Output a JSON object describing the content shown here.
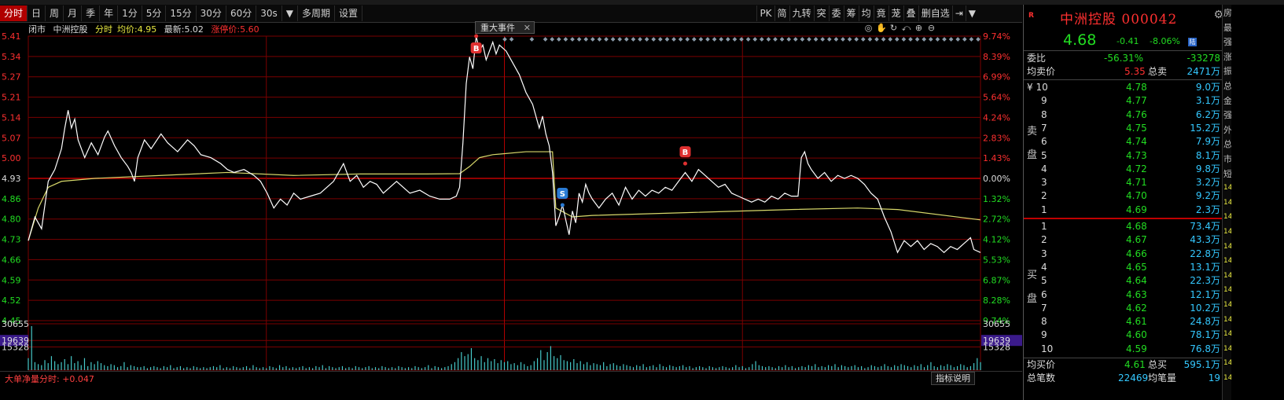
{
  "toolbar": {
    "periods": [
      "分时",
      "日",
      "周",
      "月",
      "季",
      "年",
      "1分",
      "5分",
      "15分",
      "30分",
      "60分",
      "30s",
      "▼",
      "多周期",
      "设置"
    ],
    "right_tools": [
      "PK",
      "简",
      "九转",
      "突",
      "委",
      "筹",
      "均",
      "竟",
      "茏",
      "叠",
      "删自选",
      "⇥",
      "▼"
    ]
  },
  "info": {
    "status": "闭市",
    "name": "中洲控股",
    "mode": "分时",
    "avg_label": "均价:",
    "avg": "4.95",
    "last_label": "最新:",
    "last": "5.02",
    "limit_label": "涨停价:",
    "limit": "5.60"
  },
  "events": {
    "label": "重大事件",
    "close": "✕"
  },
  "tools": [
    "◎",
    "✋",
    "↻",
    "⤺",
    "⊕",
    "⊖"
  ],
  "footer": {
    "indicator": "大单净量分时: +0.047",
    "help": "指标说明"
  },
  "chart_data": {
    "type": "line",
    "y_left_ticks": [
      "5.41",
      "5.34",
      "5.27",
      "5.21",
      "5.14",
      "5.07",
      "5.00",
      "4.93",
      "4.86",
      "4.80",
      "4.73",
      "4.66",
      "4.59",
      "4.52",
      "4.45"
    ],
    "y_right_ticks": [
      "9.74%",
      "8.39%",
      "6.99%",
      "5.64%",
      "4.24%",
      "2.83%",
      "1.43%",
      "0.00%",
      "1.32%",
      "2.72%",
      "4.12%",
      "5.53%",
      "6.87%",
      "8.28%",
      "9.74%"
    ],
    "ylim": [
      4.45,
      5.41
    ],
    "prev_close": 4.93,
    "vol_ticks_left": [
      "30655",
      "19639",
      "15328"
    ],
    "vol_ticks_right": [
      "30655",
      "19639",
      "15328"
    ],
    "vol_max": 30655,
    "highlight_volume": "19639",
    "marks": [
      {
        "label": "B",
        "t": 135,
        "price": 5.41,
        "color": "#e03030"
      },
      {
        "label": "S",
        "t": 161,
        "price": 4.84,
        "color": "#2a7bd4"
      },
      {
        "label": "B",
        "t": 198,
        "price": 4.98,
        "color": "#e03030"
      }
    ],
    "price_line": [
      [
        0,
        4.72
      ],
      [
        2,
        4.8
      ],
      [
        4,
        4.76
      ],
      [
        6,
        4.92
      ],
      [
        8,
        4.96
      ],
      [
        10,
        5.03
      ],
      [
        11,
        5.1
      ],
      [
        12,
        5.16
      ],
      [
        13,
        5.1
      ],
      [
        14,
        5.13
      ],
      [
        15,
        5.06
      ],
      [
        17,
        5.0
      ],
      [
        19,
        5.05
      ],
      [
        21,
        5.01
      ],
      [
        23,
        5.07
      ],
      [
        24,
        5.09
      ],
      [
        26,
        5.04
      ],
      [
        28,
        5.0
      ],
      [
        30,
        4.97
      ],
      [
        31,
        4.95
      ],
      [
        32,
        4.92
      ],
      [
        33,
        5.0
      ],
      [
        35,
        5.06
      ],
      [
        37,
        5.03
      ],
      [
        40,
        5.08
      ],
      [
        42,
        5.05
      ],
      [
        45,
        5.02
      ],
      [
        48,
        5.06
      ],
      [
        50,
        5.04
      ],
      [
        52,
        5.01
      ],
      [
        55,
        5.0
      ],
      [
        58,
        4.98
      ],
      [
        60,
        4.96
      ],
      [
        62,
        4.95
      ],
      [
        65,
        4.96
      ],
      [
        68,
        4.94
      ],
      [
        70,
        4.92
      ],
      [
        72,
        4.88
      ],
      [
        74,
        4.83
      ],
      [
        76,
        4.86
      ],
      [
        78,
        4.84
      ],
      [
        80,
        4.88
      ],
      [
        82,
        4.86
      ],
      [
        85,
        4.87
      ],
      [
        88,
        4.88
      ],
      [
        90,
        4.9
      ],
      [
        92,
        4.92
      ],
      [
        94,
        4.96
      ],
      [
        95,
        4.98
      ],
      [
        97,
        4.92
      ],
      [
        99,
        4.94
      ],
      [
        101,
        4.9
      ],
      [
        103,
        4.92
      ],
      [
        105,
        4.91
      ],
      [
        107,
        4.88
      ],
      [
        109,
        4.9
      ],
      [
        111,
        4.92
      ],
      [
        113,
        4.9
      ],
      [
        115,
        4.88
      ],
      [
        118,
        4.89
      ],
      [
        121,
        4.87
      ],
      [
        124,
        4.86
      ],
      [
        127,
        4.86
      ],
      [
        129,
        4.87
      ],
      [
        130,
        4.9
      ],
      [
        131,
        5.05
      ],
      [
        132,
        5.25
      ],
      [
        133,
        5.34
      ],
      [
        134,
        5.3
      ],
      [
        135,
        5.41
      ],
      [
        136,
        5.36
      ],
      [
        137,
        5.38
      ],
      [
        138,
        5.33
      ],
      [
        139,
        5.36
      ],
      [
        140,
        5.39
      ],
      [
        141,
        5.35
      ],
      [
        142,
        5.38
      ],
      [
        144,
        5.36
      ],
      [
        146,
        5.32
      ],
      [
        148,
        5.28
      ],
      [
        150,
        5.22
      ],
      [
        152,
        5.18
      ],
      [
        154,
        5.1
      ],
      [
        155,
        5.14
      ],
      [
        156,
        5.08
      ],
      [
        157,
        5.04
      ],
      [
        158,
        4.95
      ],
      [
        159,
        4.77
      ],
      [
        160,
        4.8
      ],
      [
        161,
        4.84
      ],
      [
        162,
        4.79
      ],
      [
        163,
        4.74
      ],
      [
        164,
        4.82
      ],
      [
        165,
        4.78
      ],
      [
        166,
        4.88
      ],
      [
        167,
        4.85
      ],
      [
        168,
        4.91
      ],
      [
        169,
        4.88
      ],
      [
        170,
        4.86
      ],
      [
        172,
        4.83
      ],
      [
        174,
        4.86
      ],
      [
        176,
        4.88
      ],
      [
        178,
        4.84
      ],
      [
        180,
        4.9
      ],
      [
        182,
        4.86
      ],
      [
        184,
        4.89
      ],
      [
        186,
        4.87
      ],
      [
        188,
        4.89
      ],
      [
        190,
        4.88
      ],
      [
        192,
        4.9
      ],
      [
        194,
        4.89
      ],
      [
        196,
        4.92
      ],
      [
        198,
        4.95
      ],
      [
        200,
        4.92
      ],
      [
        202,
        4.96
      ],
      [
        204,
        4.94
      ],
      [
        206,
        4.92
      ],
      [
        208,
        4.9
      ],
      [
        210,
        4.91
      ],
      [
        212,
        4.88
      ],
      [
        214,
        4.87
      ],
      [
        216,
        4.86
      ],
      [
        218,
        4.85
      ],
      [
        220,
        4.86
      ],
      [
        222,
        4.85
      ],
      [
        224,
        4.87
      ],
      [
        226,
        4.86
      ],
      [
        228,
        4.88
      ],
      [
        230,
        4.87
      ],
      [
        232,
        4.87
      ],
      [
        233,
        5.0
      ],
      [
        234,
        5.02
      ],
      [
        235,
        4.98
      ],
      [
        236,
        4.96
      ],
      [
        238,
        4.93
      ],
      [
        240,
        4.95
      ],
      [
        242,
        4.92
      ],
      [
        244,
        4.94
      ],
      [
        246,
        4.93
      ],
      [
        248,
        4.94
      ],
      [
        250,
        4.93
      ],
      [
        252,
        4.91
      ],
      [
        254,
        4.88
      ],
      [
        256,
        4.86
      ],
      [
        258,
        4.8
      ],
      [
        260,
        4.75
      ],
      [
        262,
        4.68
      ],
      [
        264,
        4.72
      ],
      [
        266,
        4.7
      ],
      [
        268,
        4.72
      ],
      [
        270,
        4.69
      ],
      [
        272,
        4.71
      ],
      [
        274,
        4.7
      ],
      [
        276,
        4.68
      ],
      [
        278,
        4.7
      ],
      [
        280,
        4.69
      ],
      [
        282,
        4.71
      ],
      [
        284,
        4.73
      ],
      [
        285,
        4.69
      ],
      [
        287,
        4.68
      ]
    ],
    "avg_line": [
      [
        0,
        4.72
      ],
      [
        3,
        4.83
      ],
      [
        6,
        4.9
      ],
      [
        10,
        4.92
      ],
      [
        20,
        4.93
      ],
      [
        40,
        4.94
      ],
      [
        60,
        4.95
      ],
      [
        80,
        4.94
      ],
      [
        100,
        4.945
      ],
      [
        120,
        4.945
      ],
      [
        130,
        4.946
      ],
      [
        133,
        4.97
      ],
      [
        136,
        5.0
      ],
      [
        140,
        5.01
      ],
      [
        150,
        5.02
      ],
      [
        158,
        5.02
      ],
      [
        159,
        4.83
      ],
      [
        164,
        4.8
      ],
      [
        170,
        4.805
      ],
      [
        200,
        4.815
      ],
      [
        230,
        4.825
      ],
      [
        250,
        4.83
      ],
      [
        262,
        4.825
      ],
      [
        287,
        4.79
      ]
    ],
    "volume": [
      12,
      44,
      8,
      6,
      5,
      10,
      7,
      14,
      9,
      6,
      8,
      11,
      6,
      14,
      7,
      9,
      5,
      12,
      4,
      8,
      6,
      9,
      7,
      5,
      4,
      6,
      5,
      3,
      4,
      8,
      3,
      5,
      4,
      3,
      3,
      4,
      2,
      3,
      4,
      3,
      2,
      4,
      3,
      5,
      2,
      3,
      4,
      2,
      3,
      2,
      4,
      3,
      2,
      3,
      2,
      3,
      4,
      3,
      5,
      2,
      3,
      2,
      4,
      3,
      2,
      3,
      4,
      2,
      5,
      3,
      2,
      3,
      2,
      4,
      3,
      2,
      5,
      3,
      4,
      2,
      3,
      2,
      3,
      4,
      2,
      3,
      2,
      4,
      3,
      5,
      2,
      4,
      3,
      2,
      3,
      4,
      2,
      3,
      2,
      4,
      3,
      2,
      3,
      4,
      2,
      3,
      2,
      4,
      3,
      2,
      3,
      2,
      4,
      3,
      2,
      3,
      2,
      4,
      3,
      2,
      3,
      5,
      2,
      4,
      3,
      2,
      3,
      4,
      6,
      8,
      12,
      18,
      14,
      16,
      22,
      12,
      10,
      14,
      8,
      12,
      9,
      11,
      7,
      10,
      8,
      9,
      6,
      7,
      5,
      8,
      6,
      4,
      5,
      9,
      12,
      20,
      10,
      18,
      24,
      14,
      12,
      15,
      10,
      9,
      8,
      11,
      7,
      9,
      6,
      8,
      5,
      7,
      6,
      5,
      8,
      4,
      6,
      7,
      5,
      4,
      6,
      5,
      4,
      3,
      5,
      4,
      6,
      3,
      4,
      5,
      3,
      6,
      4,
      3,
      5,
      4,
      3,
      4,
      5,
      3,
      4,
      2,
      3,
      4,
      3,
      2,
      4,
      3,
      2,
      3,
      4,
      3,
      2,
      3,
      5,
      3,
      4,
      2,
      3,
      6,
      9,
      5,
      4,
      3,
      4,
      3,
      2,
      4,
      3,
      5,
      3,
      4,
      2,
      3,
      4,
      3,
      5,
      4,
      6,
      3,
      4,
      3,
      5,
      4,
      6,
      3,
      5,
      4,
      3,
      4,
      5,
      3,
      4,
      2,
      3,
      5,
      4,
      3,
      4,
      6,
      4,
      3,
      5,
      4,
      6,
      5,
      4,
      3,
      5,
      4,
      6,
      3,
      5,
      8,
      4,
      3,
      5,
      4,
      6,
      5,
      3,
      4,
      6,
      5,
      3,
      4,
      7,
      12,
      8
    ]
  },
  "quote": {
    "logo": "R",
    "name": "中洲控股",
    "code": "000042",
    "price": "4.68",
    "change": "-0.41",
    "change_pct": "-8.06%",
    "market": "陆",
    "ratio_label": "委比",
    "ratio": "-56.31%",
    "ratio_diff": "-33278",
    "avg_sell_label": "均卖价",
    "avg_sell": "5.35",
    "total_sell_label": "总卖",
    "total_sell": "2471万",
    "sell_side": "卖盘",
    "buy_side": "买盘",
    "asks": [
      {
        "lv": "¥ 10",
        "price": "4.78",
        "vol": "9.0万"
      },
      {
        "lv": "9",
        "price": "4.77",
        "vol": "3.1万"
      },
      {
        "lv": "8",
        "price": "4.76",
        "vol": "6.2万"
      },
      {
        "lv": "7",
        "price": "4.75",
        "vol": "15.2万"
      },
      {
        "lv": "6",
        "price": "4.74",
        "vol": "7.9万"
      },
      {
        "lv": "5",
        "price": "4.73",
        "vol": "8.1万"
      },
      {
        "lv": "4",
        "price": "4.72",
        "vol": "9.8万"
      },
      {
        "lv": "3",
        "price": "4.71",
        "vol": "3.2万"
      },
      {
        "lv": "2",
        "price": "4.70",
        "vol": "9.2万"
      },
      {
        "lv": "1",
        "price": "4.69",
        "vol": "2.3万"
      }
    ],
    "bids": [
      {
        "lv": "1",
        "price": "4.68",
        "vol": "73.4万"
      },
      {
        "lv": "2",
        "price": "4.67",
        "vol": "43.3万"
      },
      {
        "lv": "3",
        "price": "4.66",
        "vol": "22.8万"
      },
      {
        "lv": "4",
        "price": "4.65",
        "vol": "13.1万"
      },
      {
        "lv": "5",
        "price": "4.64",
        "vol": "22.3万"
      },
      {
        "lv": "6",
        "price": "4.63",
        "vol": "12.1万"
      },
      {
        "lv": "7",
        "price": "4.62",
        "vol": "10.2万"
      },
      {
        "lv": "8",
        "price": "4.61",
        "vol": "24.8万"
      },
      {
        "lv": "9",
        "price": "4.60",
        "vol": "78.1万"
      },
      {
        "lv": "10",
        "price": "4.59",
        "vol": "76.8万"
      }
    ],
    "avg_buy_label": "均买价",
    "avg_buy": "4.61",
    "total_buy_label": "总买",
    "total_buy": "595.1万",
    "trades_label": "总笔数",
    "trades": "22469",
    "avg_lot_label": "均笔量",
    "avg_lot": "19"
  },
  "side_tabs": [
    "房",
    "最",
    "强",
    "涨",
    "振",
    "总",
    "金",
    "强",
    "外",
    "总",
    "市",
    "短",
    "14",
    "14",
    "14",
    "14",
    "14",
    "14",
    "14",
    "14",
    "14",
    "14",
    "14",
    "14",
    "14",
    "14"
  ],
  "colors": {
    "up": "#ff3030",
    "down": "#22dd22",
    "grid": "#7a0000",
    "price_line": "#ffffff",
    "avg_line": "#d8d86a",
    "volume": "#46c8c8"
  }
}
